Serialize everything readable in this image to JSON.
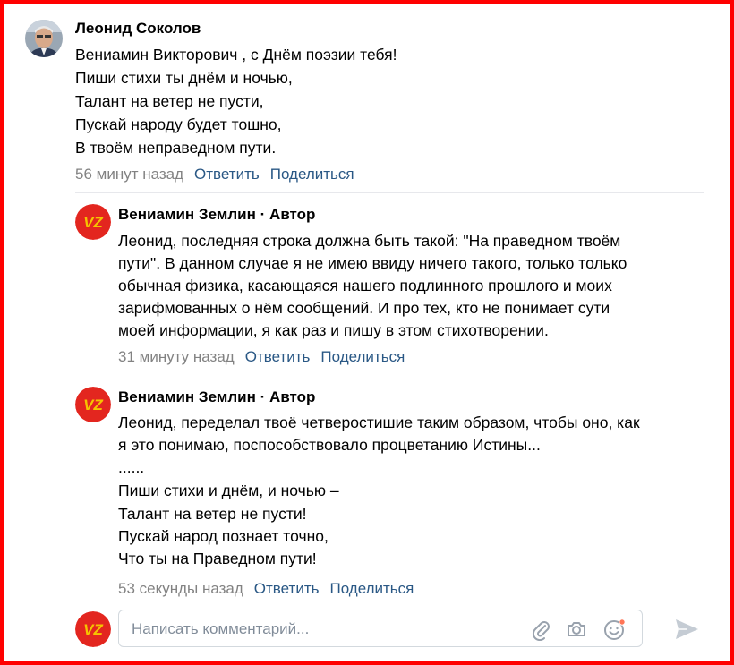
{
  "comments": [
    {
      "author": "Леонид Соколов",
      "author_role": "",
      "lines": [
        "Вениамин Викторович , с Днём поэзии тебя!",
        "Пиши стихи ты днём и ночью,",
        "Талант на ветер не пусти,",
        "Пускай народу будет тошно,",
        "В твоём неправедном пути."
      ],
      "time": "56 минут назад",
      "reply": "Ответить",
      "share": "Поделиться"
    },
    {
      "author": "Вениамин Землин",
      "author_role": "Автор",
      "lines": [
        "Леонид, последняя строка должна быть такой: \"На праведном твоём",
        "пути\". В данном случае я не имею ввиду ничего такого, только только",
        "обычная физика, касающаяся нашего подлинного прошлого и моих",
        "зарифмованных о нём сообщений. И про тех, кто не понимает сути",
        "моей информации, я как раз и пишу в этом стихотворении."
      ],
      "time": "31 минуту назад",
      "reply": "Ответить",
      "share": "Поделиться"
    },
    {
      "author": "Вениамин Землин",
      "author_role": "Автор",
      "lines": [
        "Леонид, переделал твоё четверостишие таким образом, чтобы оно, как",
        "я это понимаю, поспособствовало процветанию Истины...",
        "......",
        "Пиши стихи и днём, и ночью –",
        "Талант на ветер не пусти!",
        "Пускай народ познает точно,",
        "Что ты на Праведном пути!"
      ],
      "time": "53 секунды назад",
      "reply": "Ответить",
      "share": "Поделиться"
    }
  ],
  "author_separator": "·",
  "avatar_logo": "VZ",
  "comment_input": {
    "placeholder": "Написать комментарий...",
    "value": ""
  },
  "icons": {
    "attach": "paperclip-icon",
    "camera": "camera-icon",
    "emoji": "emoji-icon",
    "send": "send-icon"
  },
  "colors": {
    "link": "#2a5885",
    "meta": "#828282",
    "logo_red": "#e3261f",
    "logo_yellow": "#f5c400",
    "frame": "#ff0000",
    "notification_dot": "#ff7557"
  }
}
